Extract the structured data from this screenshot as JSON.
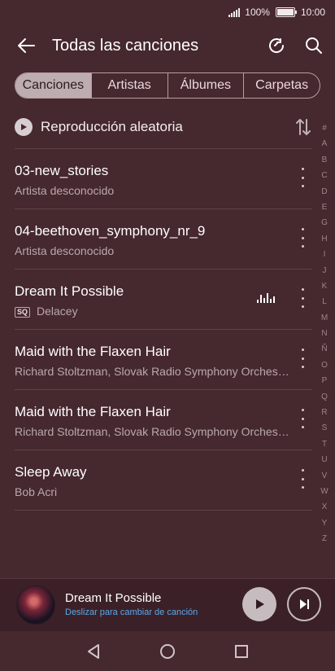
{
  "status": {
    "battery": "100%",
    "time": "10:00"
  },
  "header": {
    "title": "Todas las canciones",
    "back_icon": "arrow-left-icon",
    "refresh_icon": "refresh-icon",
    "search_icon": "search-icon"
  },
  "tabs": [
    {
      "label": "Canciones",
      "active": true
    },
    {
      "label": "Artistas",
      "active": false
    },
    {
      "label": "Álbumes",
      "active": false
    },
    {
      "label": "Carpetas",
      "active": false
    }
  ],
  "shuffle": {
    "label": "Reproducción aleatoria"
  },
  "songs": [
    {
      "title": "03-new_stories",
      "artist": "Artista desconocido",
      "badge": "",
      "playing": false
    },
    {
      "title": "04-beethoven_symphony_nr_9",
      "artist": "Artista desconocido",
      "badge": "",
      "playing": false
    },
    {
      "title": "Dream It Possible",
      "artist": "Delacey",
      "badge": "SQ",
      "playing": true
    },
    {
      "title": "Maid with the Flaxen Hair",
      "artist": "Richard Stoltzman, Slovak Radio Symphony Orchestra",
      "badge": "",
      "playing": false
    },
    {
      "title": "Maid with the Flaxen Hair",
      "artist": "Richard Stoltzman, Slovak Radio Symphony Orchestra",
      "badge": "",
      "playing": false
    },
    {
      "title": "Sleep Away",
      "artist": "Bob Acri",
      "badge": "",
      "playing": false
    }
  ],
  "index_letters": [
    "#",
    "A",
    "B",
    "C",
    "D",
    "E",
    "G",
    "H",
    "I",
    "J",
    "K",
    "L",
    "M",
    "N",
    "Ñ",
    "O",
    "P",
    "Q",
    "R",
    "S",
    "T",
    "U",
    "V",
    "W",
    "X",
    "Y",
    "Z"
  ],
  "player": {
    "title": "Dream It Possible",
    "subtitle": "Deslizar para cambiar de canción"
  },
  "colors": {
    "background": "#46282f",
    "accent_link": "#5aa8ec"
  }
}
